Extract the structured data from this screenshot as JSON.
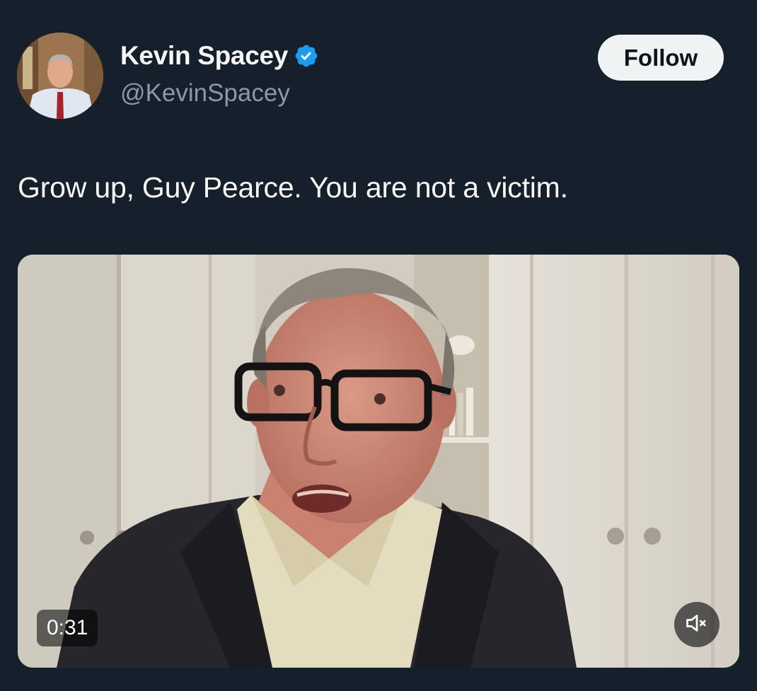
{
  "author": {
    "display_name": "Kevin Spacey",
    "handle": "@KevinSpacey",
    "verified_icon": "verified-badge-icon"
  },
  "follow_button": {
    "label": "Follow"
  },
  "tweet": {
    "text": "Grow up, Guy Pearce. You are not a victim."
  },
  "video": {
    "duration": "0:31",
    "mute_icon": "speaker-muted-icon"
  },
  "colors": {
    "background": "#15202b",
    "primary_text": "#f7f9f9",
    "secondary_text": "#8b98a5",
    "verified_blue": "#1d9bf0",
    "follow_button_bg": "#eff3f4"
  }
}
